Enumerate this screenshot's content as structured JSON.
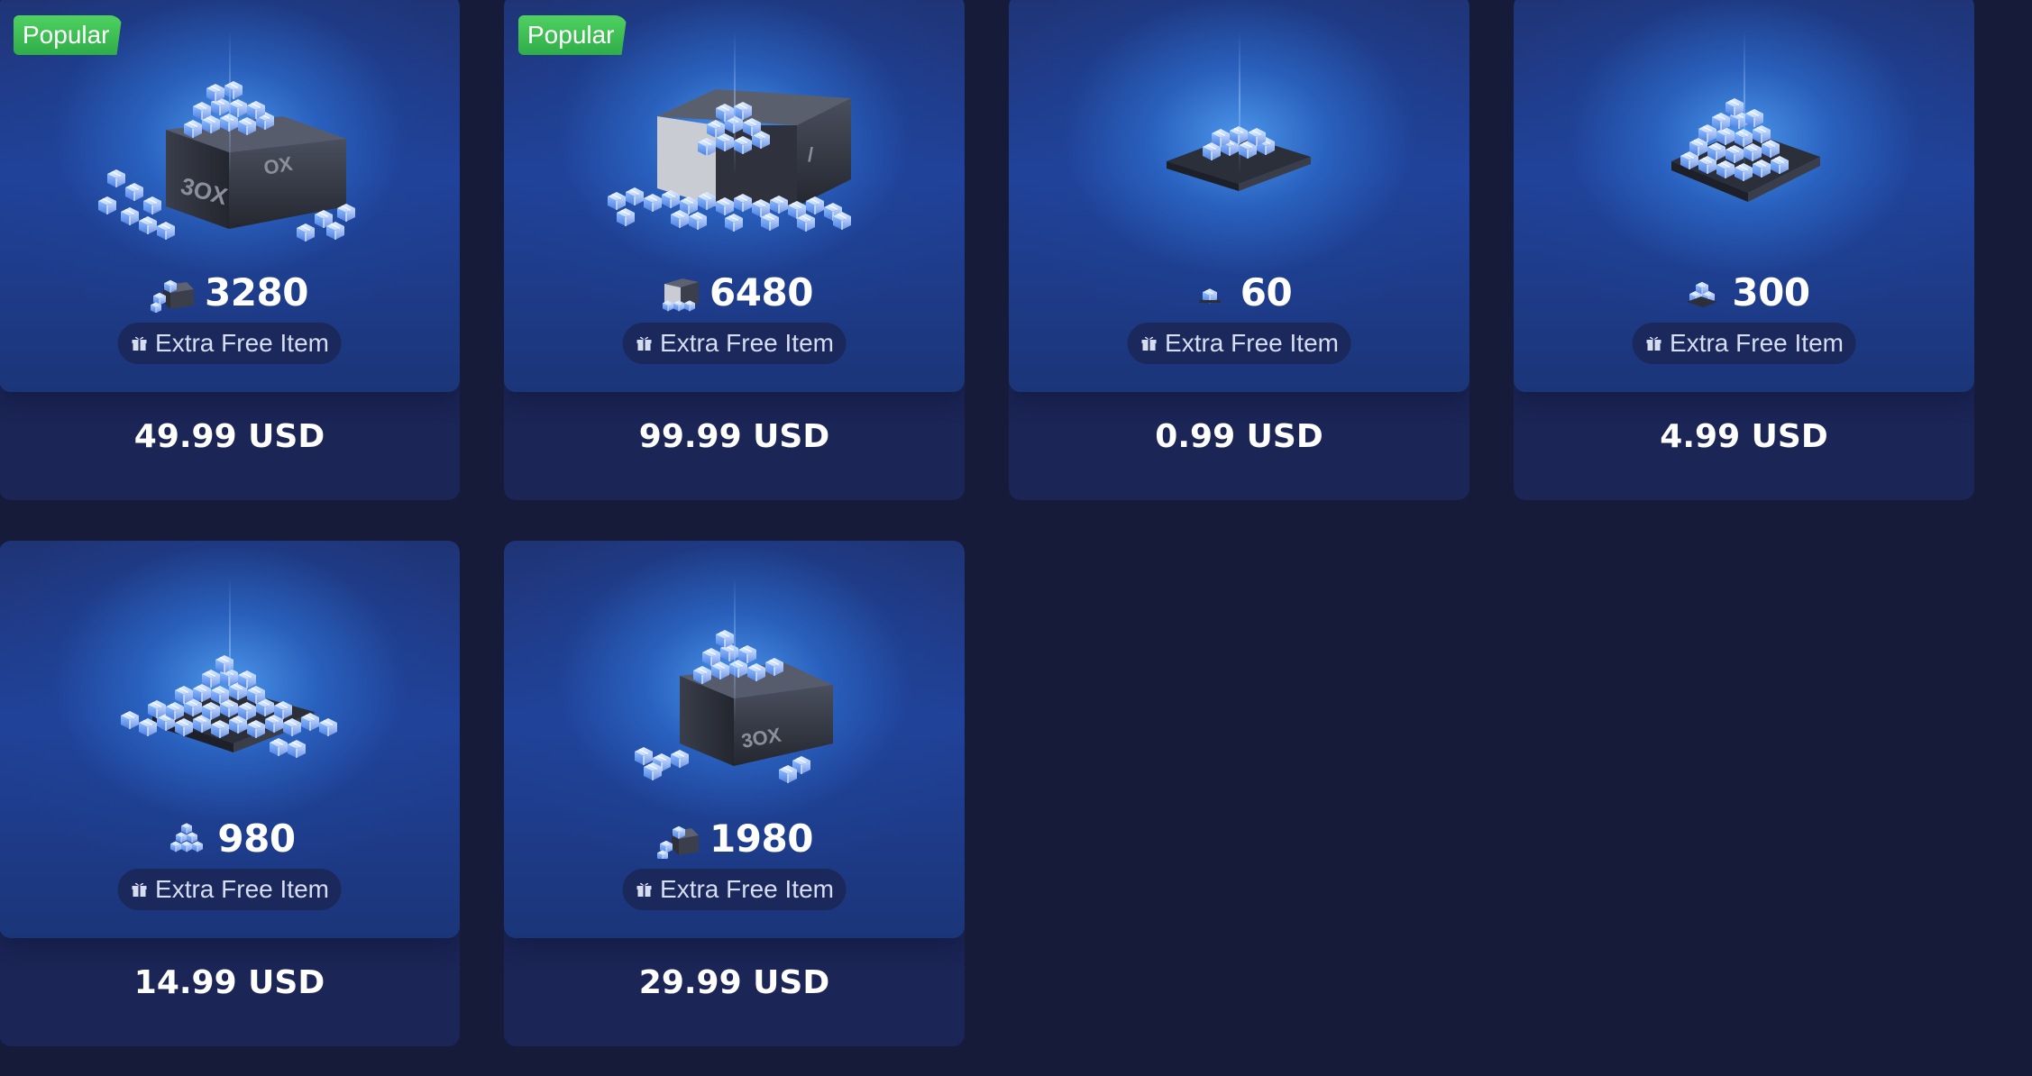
{
  "colors": {
    "page_background": "#161b3a",
    "card_background": "#1b2556",
    "card_glow": "#4e9aee",
    "popular_badge": "#3fc456",
    "text_primary": "#ffffff",
    "pill_text": "#d6ddf2"
  },
  "products": [
    {
      "badge": "Popular",
      "amount": "3280",
      "bonus_label": "Extra Free Item",
      "price": "49.99 USD",
      "art": "crate-of-gift-cubes"
    },
    {
      "badge": "Popular",
      "amount": "6480",
      "bonus_label": "Extra Free Item",
      "price": "99.99 USD",
      "art": "open-crate-of-gift-cubes"
    },
    {
      "badge": "",
      "amount": "60",
      "bonus_label": "Extra Free Item",
      "price": "0.99 USD",
      "art": "tray-of-gift-cubes-small"
    },
    {
      "badge": "",
      "amount": "300",
      "bonus_label": "Extra Free Item",
      "price": "4.99 USD",
      "art": "tray-of-gift-cubes-medium"
    },
    {
      "badge": "",
      "amount": "980",
      "bonus_label": "Extra Free Item",
      "price": "14.99 USD",
      "art": "pile-of-gift-cubes"
    },
    {
      "badge": "",
      "amount": "1980",
      "bonus_label": "Extra Free Item",
      "price": "29.99 USD",
      "art": "crate-of-gift-cubes-medium"
    }
  ]
}
